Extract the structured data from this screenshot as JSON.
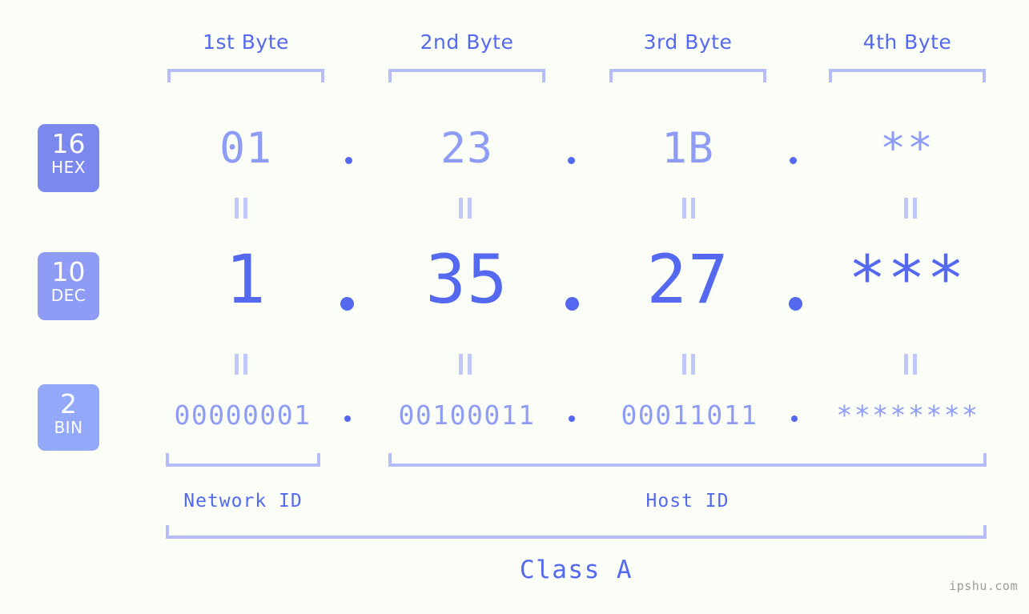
{
  "background_color": "#fbfdf7",
  "accent": {
    "primary": "#5468f0",
    "light": "#8e9cf5",
    "bracket": "#b4bdfa",
    "equals": "#c0c8fb",
    "badge_hex": "#7b89ee",
    "badge_dec": "#8e9cf5",
    "badge_bin": "#93a8f8",
    "watermark": "#9b9b9b"
  },
  "byte_headers": [
    {
      "label": "1st Byte"
    },
    {
      "label": "2nd Byte"
    },
    {
      "label": "3rd Byte"
    },
    {
      "label": "4th Byte"
    }
  ],
  "bases": [
    {
      "number": "16",
      "name": "HEX"
    },
    {
      "number": "10",
      "name": "DEC"
    },
    {
      "number": "2",
      "name": "BIN"
    }
  ],
  "rows": {
    "hex": {
      "base_number": "16",
      "base_name": "HEX",
      "values": [
        "01",
        "23",
        "1B",
        "**"
      ],
      "separator": "."
    },
    "dec": {
      "base_number": "10",
      "base_name": "DEC",
      "values": [
        "1",
        "35",
        "27",
        "***"
      ],
      "separator": "."
    },
    "bin": {
      "base_number": "2",
      "base_name": "BIN",
      "values": [
        "00000001",
        "00100011",
        "00011011",
        "********"
      ],
      "separator": "."
    }
  },
  "equals_marker": "||",
  "id_sections": [
    {
      "label": "Network ID"
    },
    {
      "label": "Host ID"
    }
  ],
  "class": {
    "label": "Class A"
  },
  "watermark": {
    "text": "ipshu.com"
  }
}
